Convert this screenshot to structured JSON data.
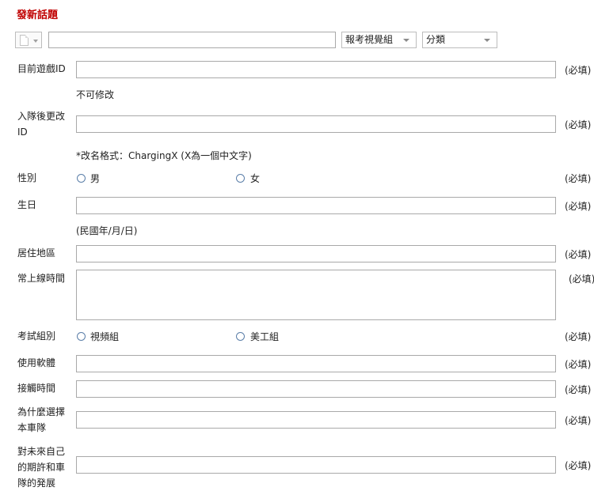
{
  "page": {
    "title": "發新話題"
  },
  "header": {
    "subject_value": "",
    "group_select": "報考視覺組",
    "category_select": "分類"
  },
  "form": {
    "current_id_label": "目前遊戲ID",
    "current_id_note": "不可修改",
    "new_id_label": "入隊後更改ID",
    "new_id_note": "*改名格式：ChargingX (X為一個中文字)",
    "gender_label": "性別",
    "gender_options": [
      "男",
      "女"
    ],
    "birthday_label": "生日",
    "birthday_note": "(民國年/月/日)",
    "residence_label": "居住地區",
    "online_time_label": "常上線時間",
    "exam_group_label": "考試組別",
    "exam_group_options": [
      "視頻組",
      "美工組"
    ],
    "software_label": "使用軟體",
    "contact_time_label": "接觸時間",
    "why_label": "為什麼選擇本車隊",
    "future_label": "對未來自己的期許和車隊的発展",
    "required_text": "(必填)"
  }
}
